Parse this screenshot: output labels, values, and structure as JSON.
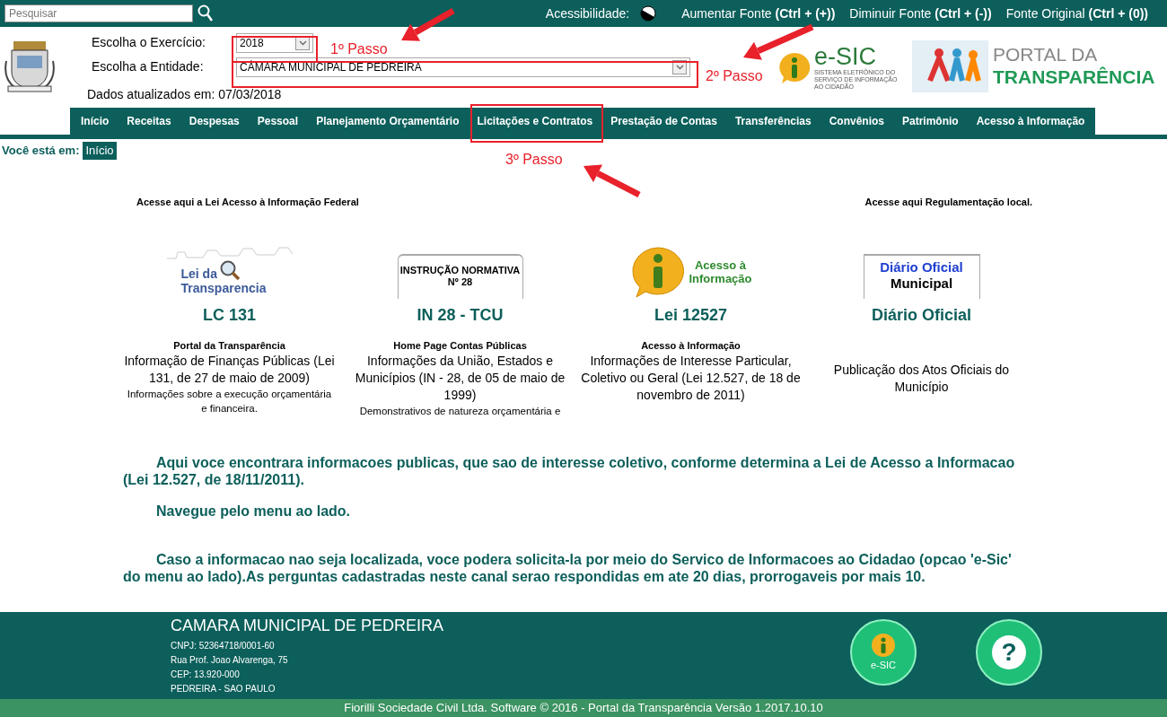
{
  "top_bar": {
    "search": {
      "placeholder": "Pesquisar"
    },
    "accessibility_label": "Acessibilidade:",
    "links": [
      {
        "label": "Aumentar Fonte",
        "shortcut": "(Ctrl + (+))"
      },
      {
        "label": "Diminuir Fonte",
        "shortcut": "(Ctrl + (-))"
      },
      {
        "label": "Fonte Original",
        "shortcut": "(Ctrl + (0))"
      }
    ]
  },
  "header": {
    "fields": [
      {
        "label": "Escolha o Exercício:",
        "value": "2018"
      },
      {
        "label": "Escolha a Entidade:",
        "value": "CÂMARA MUNICIPAL DE PEDREIRA"
      }
    ],
    "updated": "Dados atualizados em: 07/03/2018",
    "esic_logo": {
      "name": "e-SIC",
      "tagline": "SISTEMA ELETRÔNICO DO SERVIÇO DE INFORMAÇÃO AO CIDADÃO"
    },
    "portal_logo": {
      "line_1": "PORTAL DA",
      "line_2": "TRANSPARÊNCIA"
    }
  },
  "nav": [
    "Início",
    "Receitas",
    "Despesas",
    "Pessoal",
    "Planejamento Orçamentário",
    "Licitações e Contratos",
    "Prestação de Contas",
    "Transferências",
    "Convênios",
    "Patrimônio",
    "Acesso à Informação"
  ],
  "breadcrumb": {
    "label": "Você está em:",
    "current": "Início"
  },
  "annotations": [
    "1º Passo",
    "2º Passo",
    "3º Passo"
  ],
  "links_section": {
    "left_heading": "Acesse aqui a Lei Acesso à Informação Federal",
    "right_heading": "Acesse aqui Regulamentação local.",
    "cards": [
      {
        "kind": "lei",
        "logo": [
          "Lei da",
          "Transparencia"
        ],
        "title": "LC 131",
        "subtitle": "Portal da Transparência",
        "description": "Informação de Finanças Públicas (Lei 131, de 27 de maio de 2009)",
        "note": "Informações sobre a execução orçamentária e financeira."
      },
      {
        "kind": "instrucao",
        "logo": [
          "INSTRUÇÃO NORMATIVA",
          "Nº 28"
        ],
        "title": "IN 28 - TCU",
        "subtitle": "Home Page Contas Públicas",
        "description": "Informações da União, Estados e Municípios (IN - 28, de 05 de maio de 1999)",
        "note": "Demonstrativos de natureza orçamentária e"
      },
      {
        "kind": "acesso",
        "logo": [
          "Acesso à",
          "Informação"
        ],
        "title": "Lei 12527",
        "subtitle": "Acesso à Informação",
        "description": "Informações de Interesse Particular, Coletivo ou Geral (Lei 12.527, de 18 de novembro de 2011)"
      },
      {
        "kind": "diario",
        "logo": [
          "Diário Oficial",
          "Municipal"
        ],
        "title": "Diário Oficial",
        "description": "Publicação dos Atos Oficiais do Município"
      }
    ]
  },
  "intro": [
    "Aqui voce encontrara informacoes publicas, que sao de interesse coletivo, conforme determina a Lei de Acesso a Informacao (Lei 12.527, de 18/11/2011).",
    "Navegue pelo menu ao lado.",
    "Caso a informacao nao seja localizada, voce podera solicita-la por meio do Servico de Informacoes ao Cidadao (opcao 'e-Sic' do menu ao lado).As perguntas cadastradas neste canal serao respondidas em ate 20 dias, prorrogaveis por mais 10."
  ],
  "footer": {
    "name": "CAMARA MUNICIPAL DE PEDREIRA",
    "lines": [
      "CNPJ: 52364718/0001-60",
      "Rua Prof. Joao Alvarenga, 75",
      "CEP: 13.920-000",
      "PEDREIRA - SAO PAULO"
    ],
    "esic_label": "e-SIC",
    "help_symbol": "?",
    "copyright": "Fiorilli Sociedade Civil Ltda. Software © 2016 - Portal da Transparência Versão 1.2017.10.10"
  }
}
